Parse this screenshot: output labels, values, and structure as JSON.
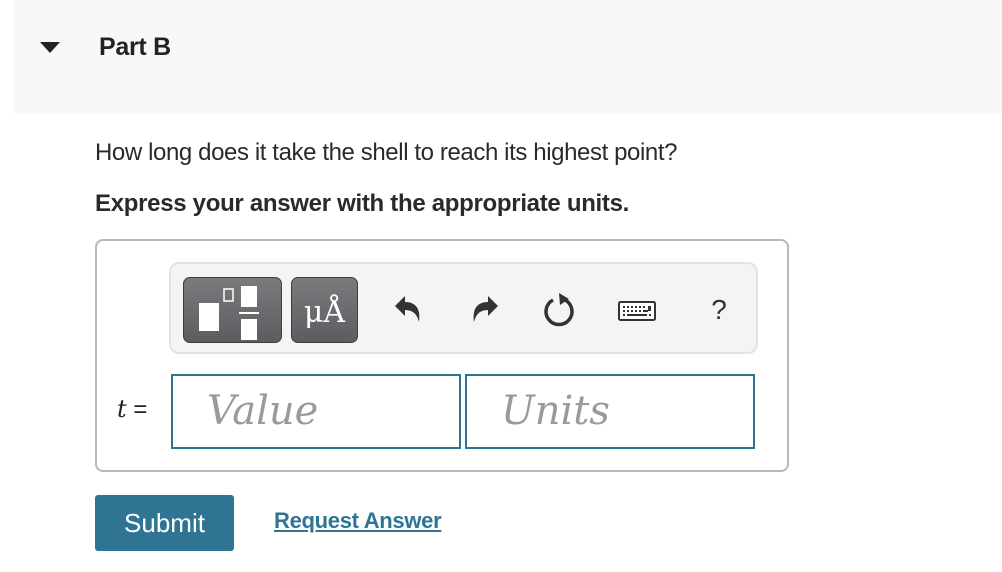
{
  "part": {
    "title": "Part B",
    "expanded": true
  },
  "question": {
    "text": "How long does it take the shell to reach its highest point?",
    "instruction": "Express your answer with the appropriate units."
  },
  "toolbar": {
    "buttons": [
      {
        "name": "templates",
        "icon": "templates-icon"
      },
      {
        "name": "units",
        "icon": "units-icon",
        "label": "μÅ"
      },
      {
        "name": "undo",
        "icon": "undo-icon"
      },
      {
        "name": "redo",
        "icon": "redo-icon"
      },
      {
        "name": "reset",
        "icon": "reset-icon"
      },
      {
        "name": "keyboard",
        "icon": "keyboard-icon"
      },
      {
        "name": "help",
        "icon": "help-icon",
        "label": "?"
      }
    ]
  },
  "answer": {
    "variable": "t",
    "equals": "=",
    "value_placeholder": "Value",
    "value": "",
    "units_placeholder": "Units",
    "units": ""
  },
  "actions": {
    "submit_label": "Submit",
    "request_label": "Request Answer"
  },
  "colors": {
    "accent": "#2f7593",
    "header_bg": "#f8f8f8",
    "toolbar_bg": "#f4f4f4"
  }
}
